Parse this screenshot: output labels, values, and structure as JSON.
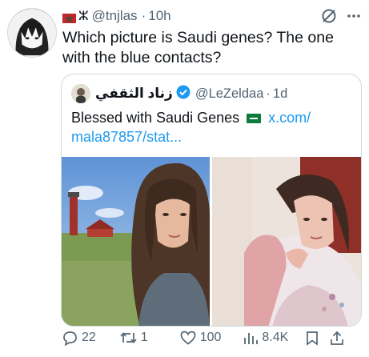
{
  "tweet": {
    "flag_emoji": "morocco-flag",
    "symbol": "ⵣ",
    "handle": "@tnjlas",
    "separator": "·",
    "time": "10h",
    "text": "Which picture is Saudi genes? The one with the blue contacts?"
  },
  "quote": {
    "display_name": "زناد الثقفي",
    "handle": "@LeZeldaa",
    "separator": "·",
    "time": "1d",
    "text_prefix": "Blessed with Saudi Genes",
    "link_text": "x.com/",
    "link_text_2": "mala87857/stat..."
  },
  "actions": {
    "replies": "22",
    "reposts": "1",
    "likes": "100",
    "views": "8.4K"
  },
  "colors": {
    "accent": "#1d9bf0",
    "muted": "#536471",
    "text": "#0f1419",
    "border": "#cfd9de"
  }
}
